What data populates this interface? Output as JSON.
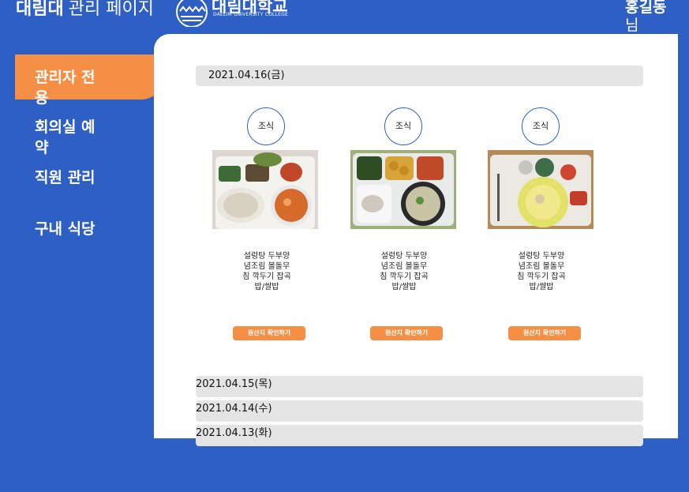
{
  "header": {
    "title_strong": "대림대",
    "title_light": "관리 페이지",
    "logo_text": "대림대학교",
    "logo_subtext": "DAELIM UNIVERSITY COLLEGE",
    "user_name": "홍길동",
    "user_suffix": "님"
  },
  "sidebar": {
    "items": [
      {
        "label": "관리자 전용",
        "active": true
      },
      {
        "label": "회의실 예약",
        "active": false
      },
      {
        "label": "직원 관리",
        "active": false
      },
      {
        "label": "구내 식당",
        "active": false
      }
    ]
  },
  "colors": {
    "brand_blue": "#2d5fc4",
    "accent_orange": "#f58f45",
    "bar_gray": "#e4e4e4"
  },
  "menu": {
    "open_date": "2021.04.16(금)",
    "meals": [
      {
        "type": "조식",
        "description": "설렁탕 두부양념조림 볼돌무침 깍두기 잡곡밥/쌀밥",
        "button": "원산지 확인하기"
      },
      {
        "type": "조식",
        "description": "설렁탕 두부양념조림 볼돌무침 깍두기 잡곡밥/쌀밥",
        "button": "원산지 확인하기"
      },
      {
        "type": "조식",
        "description": "설렁탕 두부양념조림 볼돌무침 깍두기 잡곡밥/쌀밥",
        "button": "원산지 확인하기"
      }
    ],
    "other_dates": [
      "2021.04.15(목)",
      "2021.04.14(수)",
      "2021.04.13(화)"
    ]
  }
}
